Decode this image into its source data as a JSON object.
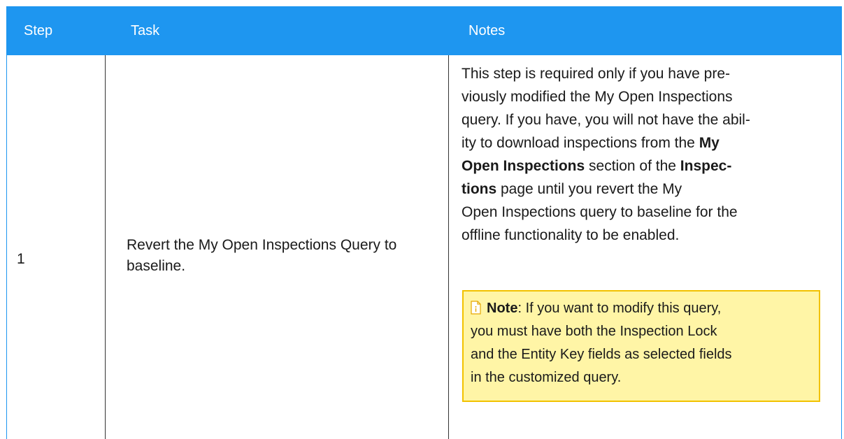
{
  "header": {
    "step": "Step",
    "task": "Task",
    "notes": "Notes"
  },
  "rows": [
    {
      "step": "1",
      "task": "Revert the My Open Inspections Query to baseline.",
      "notes": {
        "p1": "This step is required only if you have pre-",
        "p2": "viously modified the My Open Inspections",
        "p3": "query. If you have, you will not have the abil-",
        "p4a": "ity to download inspections from the ",
        "p4b": "My",
        "p5a": "Open Inspections",
        "p5b": " section of the ",
        "p5c": "Inspec-",
        "p6a": "tions",
        "p6b": " page until you revert the My",
        "p7": "Open Inspections query to baseline for the",
        "p8": "offline functionality to be enabled."
      },
      "callout": {
        "label": "Note",
        "text1": ": If you want to modify this query,",
        "text2": "you must have both the Inspection Lock",
        "text3": "and the Entity Key fields as selected fields",
        "text4": "in the customized query.",
        "icon": "note-info-icon"
      }
    }
  ],
  "colors": {
    "header_bg": "#1e96f0",
    "callout_bg": "#fff5a6",
    "callout_border": "#f2c200"
  }
}
